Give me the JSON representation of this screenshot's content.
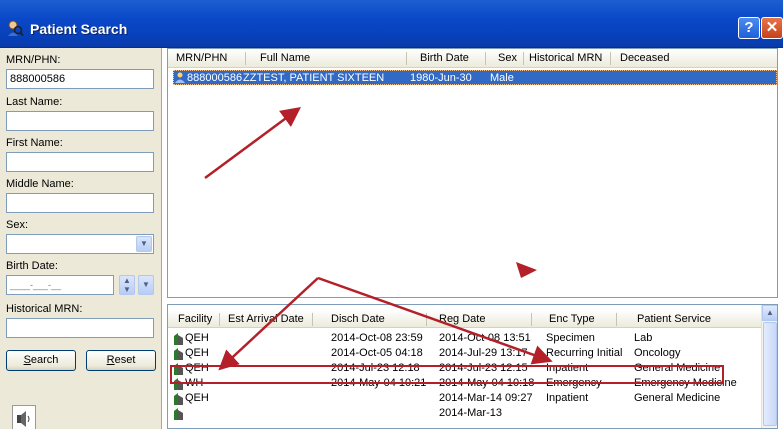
{
  "window": {
    "title": "Patient Search",
    "help_label": "?",
    "close_label": "✕"
  },
  "search": {
    "mrn_label": "MRN/PHN:",
    "mrn_value": "888000586",
    "last_name_label": "Last Name:",
    "first_name_label": "First Name:",
    "middle_name_label": "Middle Name:",
    "sex_label": "Sex:",
    "birth_date_label": "Birth Date:",
    "birth_date_placeholder": "____-___-__",
    "historical_mrn_label": "Historical MRN:",
    "search_label_u": "S",
    "search_label_rest": "earch",
    "reset_label_u": "R",
    "reset_label_rest": "eset"
  },
  "results": {
    "columns": [
      "MRN/PHN",
      "Full Name",
      "Birth Date",
      "Sex",
      "Historical MRN",
      "Deceased"
    ],
    "rows": [
      {
        "mrn": "888000586",
        "name": "ZZTEST, PATIENT SIXTEEN",
        "birth": "1980-Jun-30",
        "sex": "Male",
        "hist": "",
        "deceased": ""
      }
    ]
  },
  "encounters": {
    "columns": [
      "Facility",
      "Est Arrival Date",
      "Disch Date",
      "Reg Date",
      "Enc Type",
      "Patient Service"
    ],
    "rows": [
      {
        "facility": "QEH",
        "arrival": "",
        "disch": "2014-Oct-08 23:59",
        "reg": "2014-Oct-08 13:51",
        "type": "Specimen",
        "service": "Lab"
      },
      {
        "facility": "QEH",
        "arrival": "",
        "disch": "2014-Oct-05 04:18",
        "reg": "2014-Jul-29 13:17",
        "type": "Recurring Initial",
        "service": "Oncology"
      },
      {
        "facility": "QEH",
        "arrival": "",
        "disch": "2014-Jul-23 12:18",
        "reg": "2014-Jul-23 12:15",
        "type": "Inpatient",
        "service": "General Medicine"
      },
      {
        "facility": "WH",
        "arrival": "",
        "disch": "2014-May-04 10:21",
        "reg": "2014-May-04 10:18",
        "type": "Emergency",
        "service": "Emergency Medicine"
      },
      {
        "facility": "QEH",
        "arrival": "",
        "disch": "",
        "reg": "2014-Mar-14 09:27",
        "type": "Inpatient",
        "service": "General Medicine"
      },
      {
        "facility": "",
        "arrival": "",
        "disch": "",
        "reg": "2014-Mar-13",
        "type": "",
        "service": ""
      }
    ]
  },
  "colors": {
    "selection": "#316ac5",
    "annotation": "#b3202a"
  }
}
